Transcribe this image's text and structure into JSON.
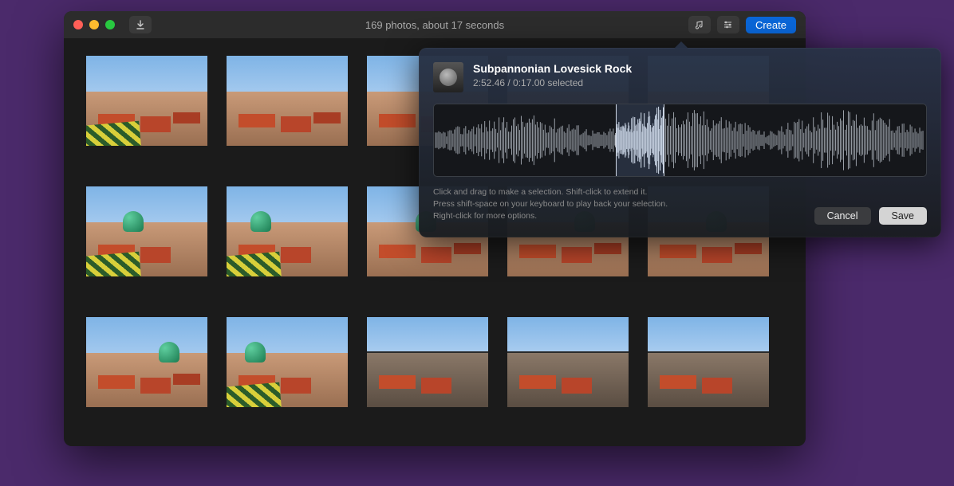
{
  "title": "169 photos, about 17 seconds",
  "create_label": "Create",
  "popover": {
    "track_title": "Subpannonian Lovesick Rock",
    "track_subtitle": "2:52.46 / 0:17.00 selected",
    "hint_line1": "Click and drag to make a selection. Shift-click to extend it.",
    "hint_line2": "Press shift-space on your keyboard to play back your selection.",
    "hint_line3": "Right-click for more options.",
    "cancel_label": "Cancel",
    "save_label": "Save"
  }
}
